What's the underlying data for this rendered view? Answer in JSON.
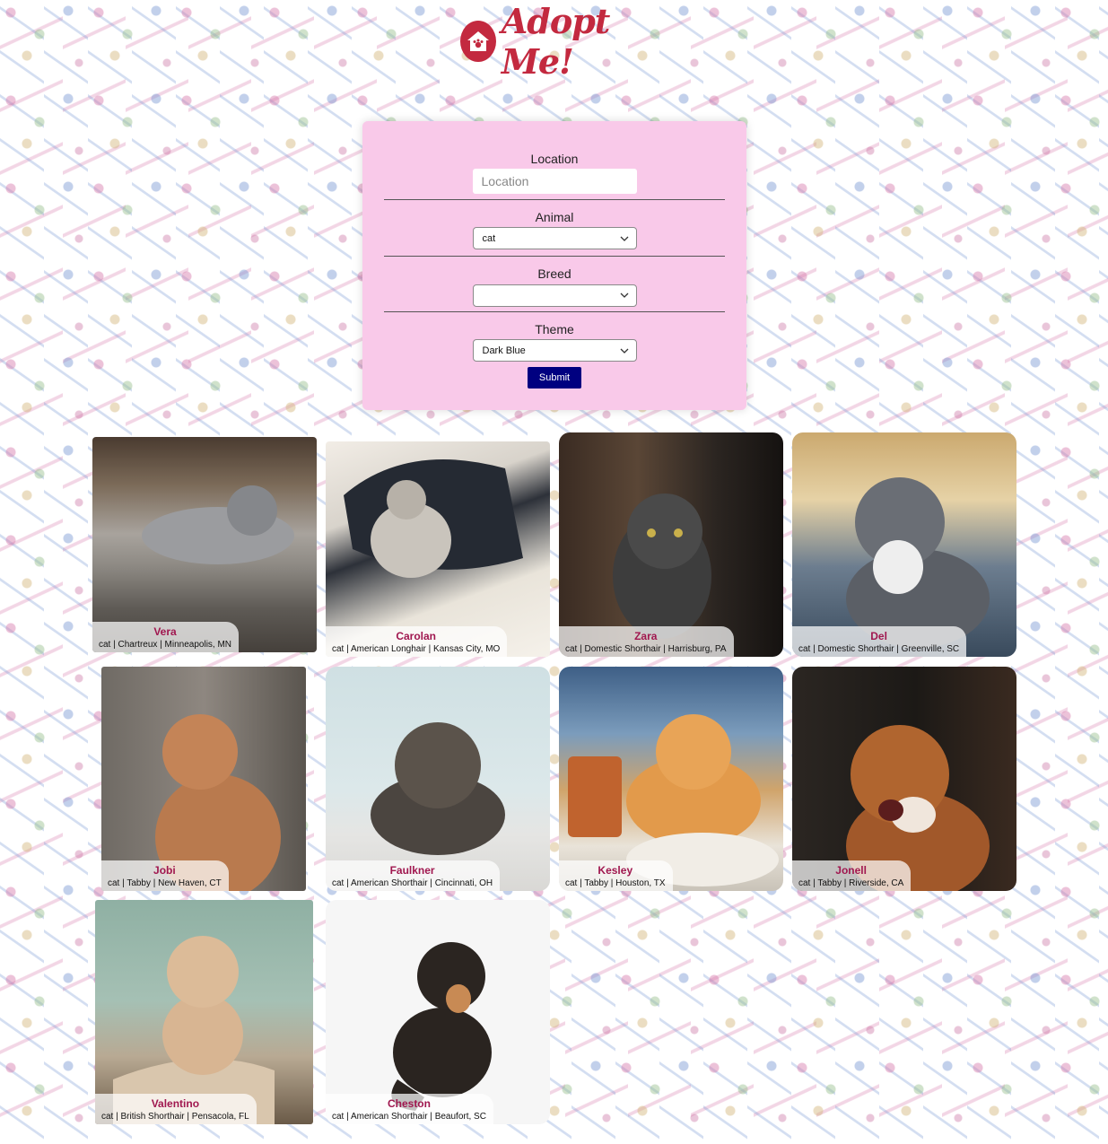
{
  "header": {
    "logo_text": "Adopt Me!"
  },
  "search": {
    "location_label": "Location",
    "location_placeholder": "Location",
    "animal_label": "Animal",
    "animal_value": "cat",
    "breed_label": "Breed",
    "breed_value": "",
    "theme_label": "Theme",
    "theme_value": "Dark Blue",
    "submit_label": "Submit",
    "submit_color": "#000080"
  },
  "pets": [
    {
      "name": "Vera",
      "desc": "cat | Chartreux | Minneapolis, MN"
    },
    {
      "name": "Carolan",
      "desc": "cat | American Longhair | Kansas City, MO"
    },
    {
      "name": "Zara",
      "desc": "cat | Domestic Shorthair | Harrisburg, PA"
    },
    {
      "name": "Del",
      "desc": "cat | Domestic Shorthair | Greenville, SC"
    },
    {
      "name": "Jobi",
      "desc": "cat | Tabby | New Haven, CT"
    },
    {
      "name": "Faulkner",
      "desc": "cat | American Shorthair | Cincinnati, OH"
    },
    {
      "name": "Kesley",
      "desc": "cat | Tabby | Houston, TX"
    },
    {
      "name": "Jonell",
      "desc": "cat | Tabby | Riverside, CA"
    },
    {
      "name": "Valentino",
      "desc": "cat | British Shorthair | Pensacola, FL"
    },
    {
      "name": "Cheston",
      "desc": "cat | American Shorthair | Beaufort, SC"
    }
  ],
  "colors": {
    "brand": "#c3293f",
    "panel": "#f9c9e9",
    "pet_name": "#a0174f"
  }
}
